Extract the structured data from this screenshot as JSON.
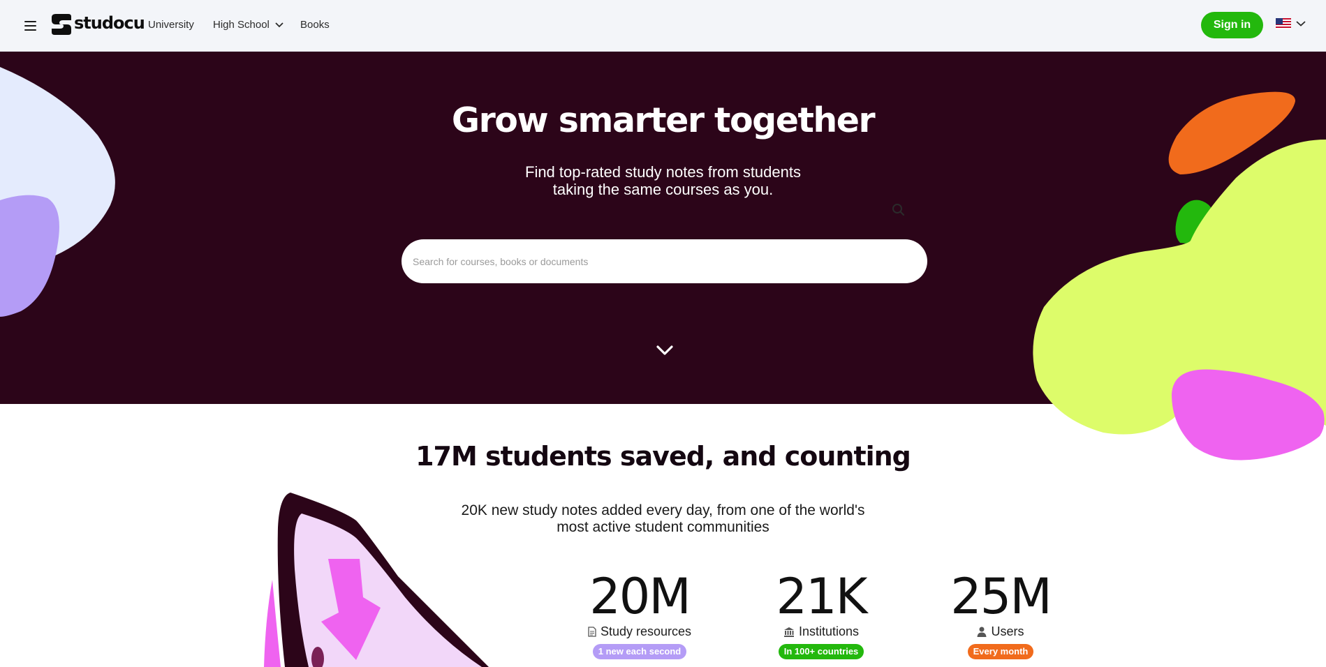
{
  "header": {
    "logo_text": "studocu",
    "nav": [
      {
        "label": "University"
      },
      {
        "label": "High School"
      },
      {
        "label": "Books"
      }
    ],
    "signin_label": "Sign in",
    "language_flag": "us-flag-icon"
  },
  "hero": {
    "title": "Grow smarter together",
    "subtitle_line1": "Find top-rated study notes from students",
    "subtitle_line2": "taking the same courses as you.",
    "search_placeholder": "Search for courses, books or documents"
  },
  "stats": {
    "title": "17M students saved, and counting",
    "subtitle_line1": "20K new study notes added every day, from one of the world's",
    "subtitle_line2": "most active student communities",
    "items": [
      {
        "value": "20M",
        "label": "Study resources",
        "icon": "document-icon",
        "pill": "1 new each second",
        "pill_color": "#b49cf6"
      },
      {
        "value": "21K",
        "label": "Institutions",
        "icon": "institution-icon",
        "pill": "In 100+ countries",
        "pill_color": "#23b80d"
      },
      {
        "value": "25M",
        "label": "Users",
        "icon": "user-icon",
        "pill": "Every month",
        "pill_color": "#f16b1c"
      }
    ]
  },
  "colors": {
    "hero_bg": "#2c0519",
    "accent_green": "#23b80d",
    "blob_lime": "#ddfc6a",
    "blob_orange": "#f16b1c",
    "blob_pink": "#ef63f0",
    "blob_lavender": "#b49cf6",
    "blob_lightblue": "#e4ebfd"
  }
}
